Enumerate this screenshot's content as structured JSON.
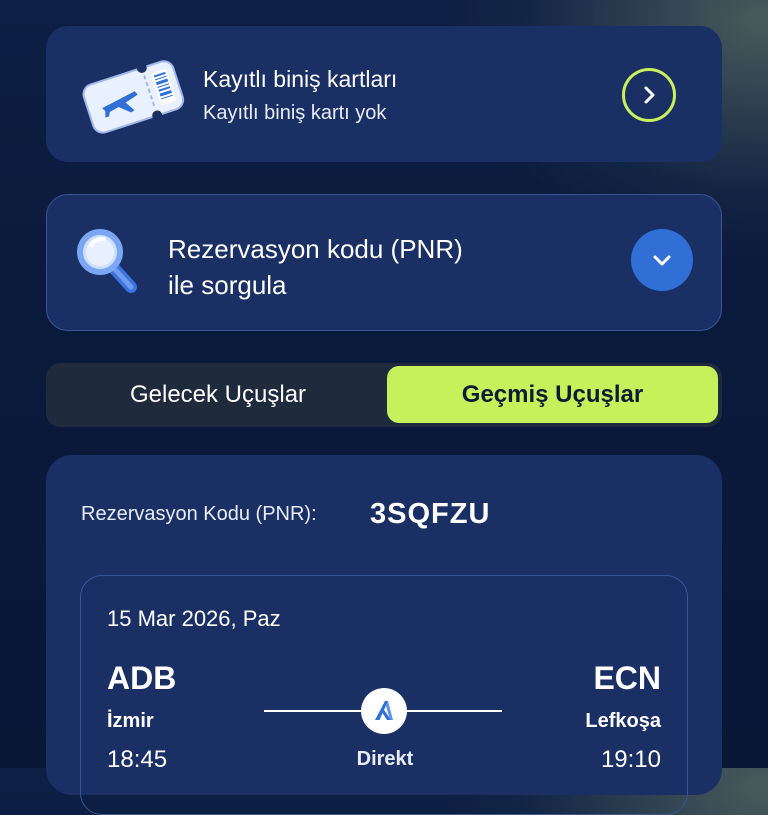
{
  "saved_boarding": {
    "title": "Kayıtlı biniş kartları",
    "subtitle": "Kayıtlı biniş kartı yok",
    "icon": "boarding-pass-ticket-icon",
    "action_icon": "chevron-right-icon"
  },
  "pnr_query": {
    "title_line1": "Rezervasyon kodu (PNR)",
    "title_line2": "ile sorgula",
    "icon": "magnifier-icon",
    "action_icon": "chevron-down-icon"
  },
  "tabs": [
    {
      "label": "Gelecek Uçuşlar",
      "selected": false
    },
    {
      "label": "Geçmiş Uçuşlar",
      "selected": true
    }
  ],
  "booking": {
    "pnr_label": "Rezervasyon Kodu (PNR):",
    "pnr_value": "3SQFZU",
    "flight": {
      "date": "15 Mar 2026, Paz",
      "departure": {
        "code": "ADB",
        "city": "İzmir",
        "time": "18:45"
      },
      "arrival": {
        "code": "ECN",
        "city": "Lefkoşa",
        "time": "19:10"
      },
      "type": "Direkt",
      "airline_icon": "airline-logo-icon"
    }
  },
  "colors": {
    "background": "#0a1a3c",
    "card": "#1a3064",
    "accent_green": "#c7f05a",
    "accent_blue": "#2f6fd6"
  }
}
